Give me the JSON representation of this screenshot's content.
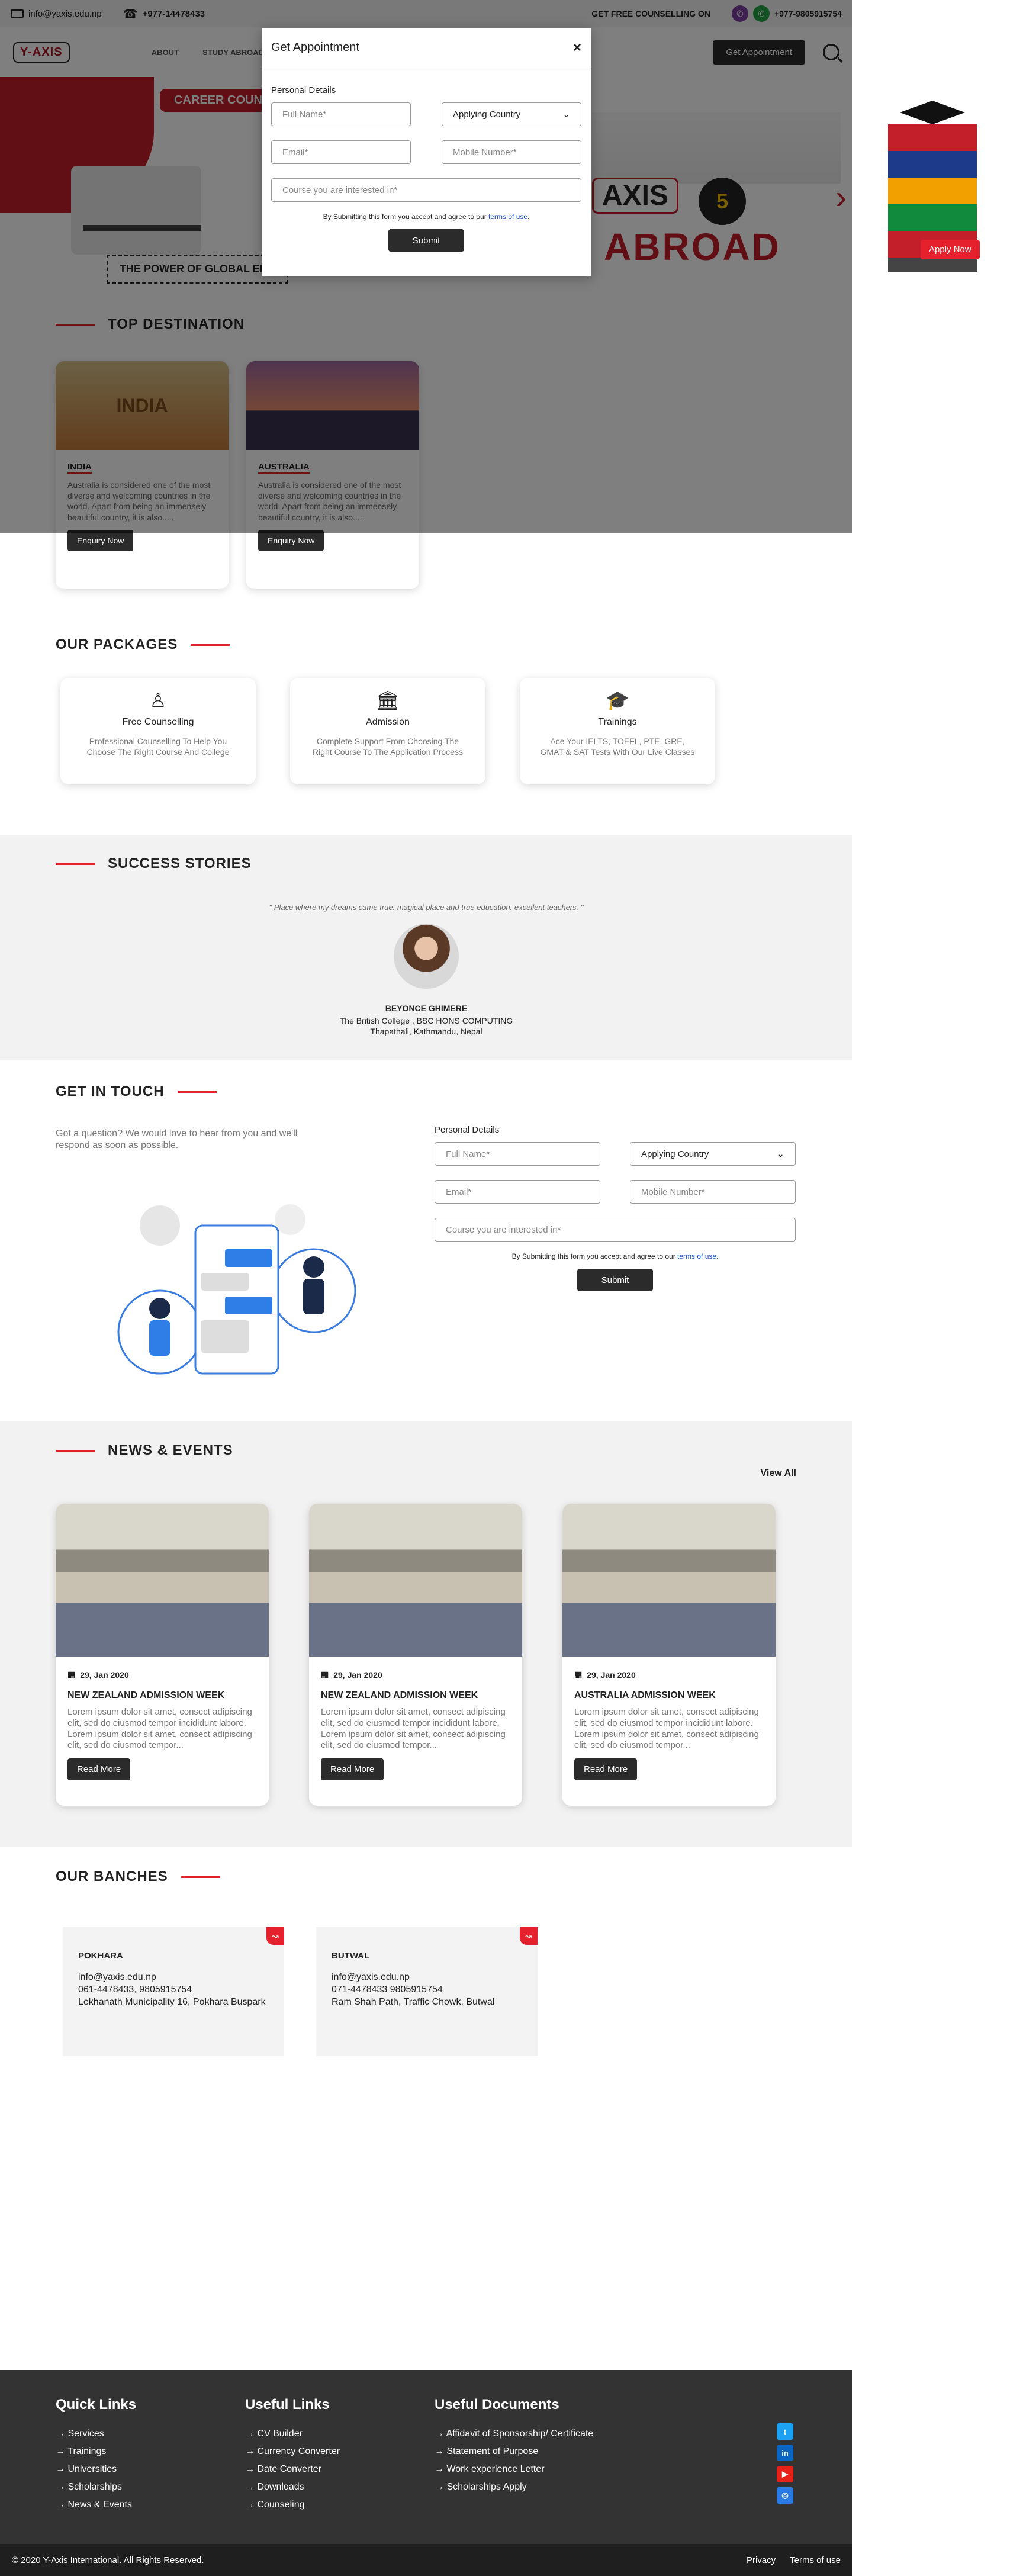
{
  "topbar": {
    "email": "info@yaxis.edu.np",
    "phone": "+977-14478433",
    "counselling": "GET FREE COUNSELLING ON",
    "mobile": "+977-9805915754"
  },
  "nav": {
    "logo": "Y-AXIS",
    "items": [
      "ABOUT",
      "STUDY ABROAD"
    ],
    "cta": "Get Appointment"
  },
  "hero": {
    "career": "CAREER COUNSE",
    "power": "THE POWER OF GLOBAL EDU",
    "brand": "AXIS",
    "abroad": "ABROAD",
    "badge": "5"
  },
  "modal": {
    "title": "Get Appointment",
    "close": "×",
    "section": "Personal Details",
    "full_name": "Full Name*",
    "country": "Applying Country",
    "email": "Email*",
    "mobile": "Mobile Number*",
    "course": "Course you are interested in*",
    "agree": "By Submitting this form you accept and agree to our ",
    "terms": "terms of use",
    "submit": "Submit"
  },
  "promo": {
    "apply": "Apply Now"
  },
  "destinations": {
    "title": "TOP DESTINATION",
    "cards": [
      {
        "name": "INDIA",
        "img_text": "INDIA",
        "text": "Australia is considered one of the most diverse and welcoming countries in the world. Apart from being an immensely beautiful country, it is also.....",
        "button": "Enquiry Now"
      },
      {
        "name": "AUSTRALIA",
        "img_text": "",
        "text": "Australia is considered one of the most diverse and welcoming countries in the world. Apart from being an immensely beautiful country, it is also.....",
        "button": "Enquiry Now"
      }
    ]
  },
  "packages": {
    "title": "OUR PACKAGES",
    "items": [
      {
        "title": "Free Counselling",
        "icon": "♙",
        "text": "Professional Counselling To Help You Choose The Right Course And College"
      },
      {
        "title": "Admission",
        "icon": "🏛",
        "text": "Complete Support From Choosing The Right Course To The Application Process"
      },
      {
        "title": "Trainings",
        "icon": "🎓",
        "text": "Ace Your IELTS, TOEFL, PTE, GRE, GMAT & SAT Tests With Our Live Classes"
      }
    ]
  },
  "stories": {
    "title": "SUCCESS STORIES",
    "quote": "\" Place where my dreams came true. magical place and true education. excellent teachers. \"",
    "name": "BEYONCE GHIMERE",
    "college": "The British College , BSC HONS COMPUTING",
    "place": "Thapathali, Kathmandu, Nepal"
  },
  "touch": {
    "title": "GET IN TOUCH",
    "intro": "Got a question? We would love to hear from you and we'll respond as soon as possible.",
    "section": "Personal Details",
    "full_name": "Full Name*",
    "country": "Applying Country",
    "email": "Email*",
    "mobile": "Mobile Number*",
    "course": "Course you are interested in*",
    "agree": "By Submitting this form you accept and agree to our ",
    "terms": "terms of use",
    "submit": "Submit"
  },
  "news": {
    "title": "NEWS & EVENTS",
    "view_all": "View All",
    "items": [
      {
        "date": "29, Jan 2020",
        "title": "NEW ZEALAND ADMISSION WEEK",
        "text": "Lorem ipsum dolor sit amet, consect adipiscing elit, sed do eiusmod tempor incididunt labore. Lorem ipsum dolor sit amet, consect adipiscing elit, sed do eiusmod tempor...",
        "button": "Read More"
      },
      {
        "date": "29, Jan 2020",
        "title": "NEW ZEALAND ADMISSION WEEK",
        "text": "Lorem ipsum dolor sit amet, consect adipiscing elit, sed do eiusmod tempor incididunt labore. Lorem ipsum dolor sit amet, consect adipiscing elit, sed do eiusmod tempor...",
        "button": "Read More"
      },
      {
        "date": "29, Jan 2020",
        "title": "AUSTRALIA ADMISSION WEEK",
        "text": "Lorem ipsum dolor sit amet, consect adipiscing elit, sed do eiusmod tempor incididunt labore. Lorem ipsum dolor sit amet, consect adipiscing elit, sed do eiusmod tempor...",
        "button": "Read More"
      }
    ]
  },
  "branches": {
    "title": "OUR BANCHES",
    "items": [
      {
        "name": "POKHARA",
        "email": "info@yaxis.edu.np",
        "phone": "061-4478433, 9805915754",
        "address": "Lekhanath Municipality 16, Pokhara Buspark"
      },
      {
        "name": "BUTWAL",
        "email": "info@yaxis.edu.np",
        "phone": "071-4478433 9805915754",
        "address": "Ram Shah Path, Traffic Chowk, Butwal"
      }
    ]
  },
  "footer": {
    "quick_title": "Quick Links",
    "quick": [
      "Services",
      "Trainings",
      "Universities",
      "Scholarships",
      "News & Events"
    ],
    "useful_title": "Useful Links",
    "useful": [
      "CV Builder",
      "Currency Converter",
      "Date Converter",
      "Downloads",
      "Counseling"
    ],
    "docs_title": "Useful Documents",
    "docs": [
      "Affidavit of Sponsorship/ Certificate",
      "Statement of Purpose",
      "Work experience Letter",
      "Scholarships Apply"
    ],
    "copyright": "© 2020 Y-Axis International. All Rights Reserved.",
    "privacy": "Privacy",
    "terms": "Terms of use"
  },
  "colors": {
    "accent": "#e4212d",
    "dark": "#2b2b2b",
    "footer": "#333333"
  }
}
